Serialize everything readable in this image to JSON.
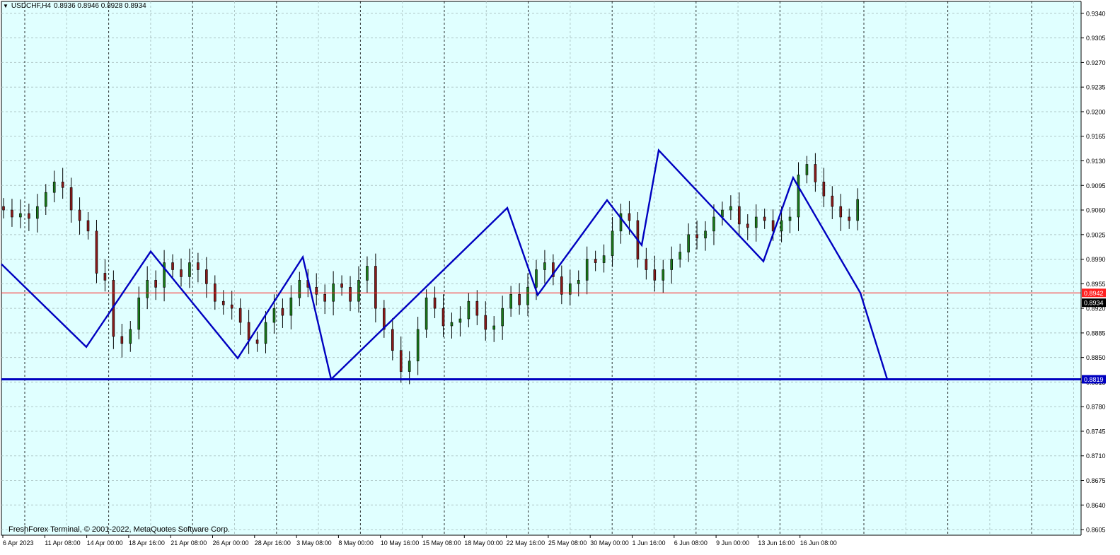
{
  "symbol_info": {
    "arrow": "▼",
    "symbol": "USDCHF,H4",
    "ohlc": "0.8936 0.8946 0.8928 0.8934"
  },
  "copyright": "FreshForex Terminal, © 2001-2022, MetaQuotes Software Corp.",
  "colors": {
    "chart_bg": "#e0ffff",
    "grid": "#b0c8c8",
    "bull_candle": "#1a7a1a",
    "bear_candle": "#8b1a1a",
    "zigzag": "#0000c0",
    "bid_line": "#ff2020",
    "support_line": "#0000c0"
  },
  "price_axis": {
    "labels": [
      "0.9340",
      "0.9305",
      "0.9270",
      "0.9235",
      "0.9200",
      "0.9165",
      "0.9130",
      "0.9095",
      "0.9060",
      "0.9025",
      "0.8990",
      "0.8955",
      "0.8920",
      "0.8885",
      "0.8850",
      "0.8815",
      "0.8780",
      "0.8745",
      "0.8710",
      "0.8675",
      "0.8640",
      "0.8605"
    ],
    "ask_price": "0.8942",
    "bid_price": "0.8934",
    "level_price": "0.8819"
  },
  "time_axis": {
    "labels": [
      "6 Apr 2023",
      "11 Apr 08:00",
      "14 Apr 00:00",
      "18 Apr 16:00",
      "21 Apr 08:00",
      "26 Apr 00:00",
      "28 Apr 16:00",
      "3 May 08:00",
      "8 May 00:00",
      "10 May 16:00",
      "15 May 08:00",
      "18 May 00:00",
      "22 May 16:00",
      "25 May 08:00",
      "30 May 00:00",
      "1 Jun 16:00",
      "6 Jun 08:00",
      "9 Jun 00:00",
      "13 Jun 16:00",
      "16 Jun 08:00"
    ]
  },
  "chart_data": {
    "type": "candlestick",
    "symbol": "USDCHF",
    "timeframe": "H4",
    "ylim": [
      0.8597,
      0.9357
    ],
    "grid": true,
    "price_levels": {
      "bid": 0.8942,
      "last": 0.8934,
      "support": 0.8819
    },
    "zigzag": [
      {
        "time": "6 Apr 2023",
        "price": 0.8983
      },
      {
        "time": "13 Apr",
        "price": 0.8865
      },
      {
        "time": "18 Apr",
        "price": 0.9001
      },
      {
        "time": "25 Apr",
        "price": 0.8849
      },
      {
        "time": "28 Apr",
        "price": 0.8993
      },
      {
        "time": "3 May",
        "price": 0.8819
      },
      {
        "time": "18 May",
        "price": 0.9063
      },
      {
        "time": "22 May",
        "price": 0.8939
      },
      {
        "time": "26 May",
        "price": 0.9074
      },
      {
        "time": "30 May",
        "price": 0.901
      },
      {
        "time": "31 May",
        "price": 0.9145
      },
      {
        "time": "8 Jun",
        "price": 0.8987
      },
      {
        "time": "12 Jun",
        "price": 0.9106
      },
      {
        "time": "16 Jun",
        "price": 0.8942
      },
      {
        "time": "20 Jun",
        "price": 0.8819
      }
    ],
    "closes": [
      0.906,
      0.905,
      0.9055,
      0.9048,
      0.9065,
      0.9085,
      0.91,
      0.9092,
      0.906,
      0.9045,
      0.903,
      0.897,
      0.896,
      0.888,
      0.887,
      0.889,
      0.8935,
      0.896,
      0.895,
      0.8985,
      0.8975,
      0.8965,
      0.8985,
      0.8975,
      0.8955,
      0.893,
      0.8925,
      0.892,
      0.89,
      0.8875,
      0.887,
      0.89,
      0.892,
      0.891,
      0.8935,
      0.896,
      0.895,
      0.894,
      0.893,
      0.8955,
      0.895,
      0.893,
      0.896,
      0.898,
      0.892,
      0.889,
      0.886,
      0.883,
      0.8845,
      0.889,
      0.8935,
      0.892,
      0.8895,
      0.89,
      0.8905,
      0.893,
      0.891,
      0.889,
      0.8895,
      0.892,
      0.894,
      0.8925,
      0.895,
      0.8975,
      0.8985,
      0.8965,
      0.894,
      0.8955,
      0.896,
      0.899,
      0.8985,
      0.8995,
      0.903,
      0.9055,
      0.9045,
      0.899,
      0.8975,
      0.896,
      0.8975,
      0.899,
      0.9,
      0.9025,
      0.902,
      0.903,
      0.905,
      0.906,
      0.9065,
      0.904,
      0.9035,
      0.905,
      0.9045,
      0.903,
      0.9045,
      0.905,
      0.911,
      0.9125,
      0.91,
      0.908,
      0.9065,
      0.905,
      0.9045,
      0.9075,
      0.909,
      0.91,
      0.906,
      0.9045,
      0.9075,
      0.908,
      0.907,
      0.9085,
      0.909,
      0.906,
      0.903,
      0.8995,
      0.9,
      0.902,
      0.903,
      0.906,
      0.909,
      0.91,
      0.908,
      0.906,
      0.905,
      0.904,
      0.903,
      0.8995,
      0.897,
      0.8975,
      0.9,
      0.901,
      0.904,
      0.9025,
      0.891,
      0.8915,
      0.892,
      0.893,
      0.8934
    ]
  }
}
